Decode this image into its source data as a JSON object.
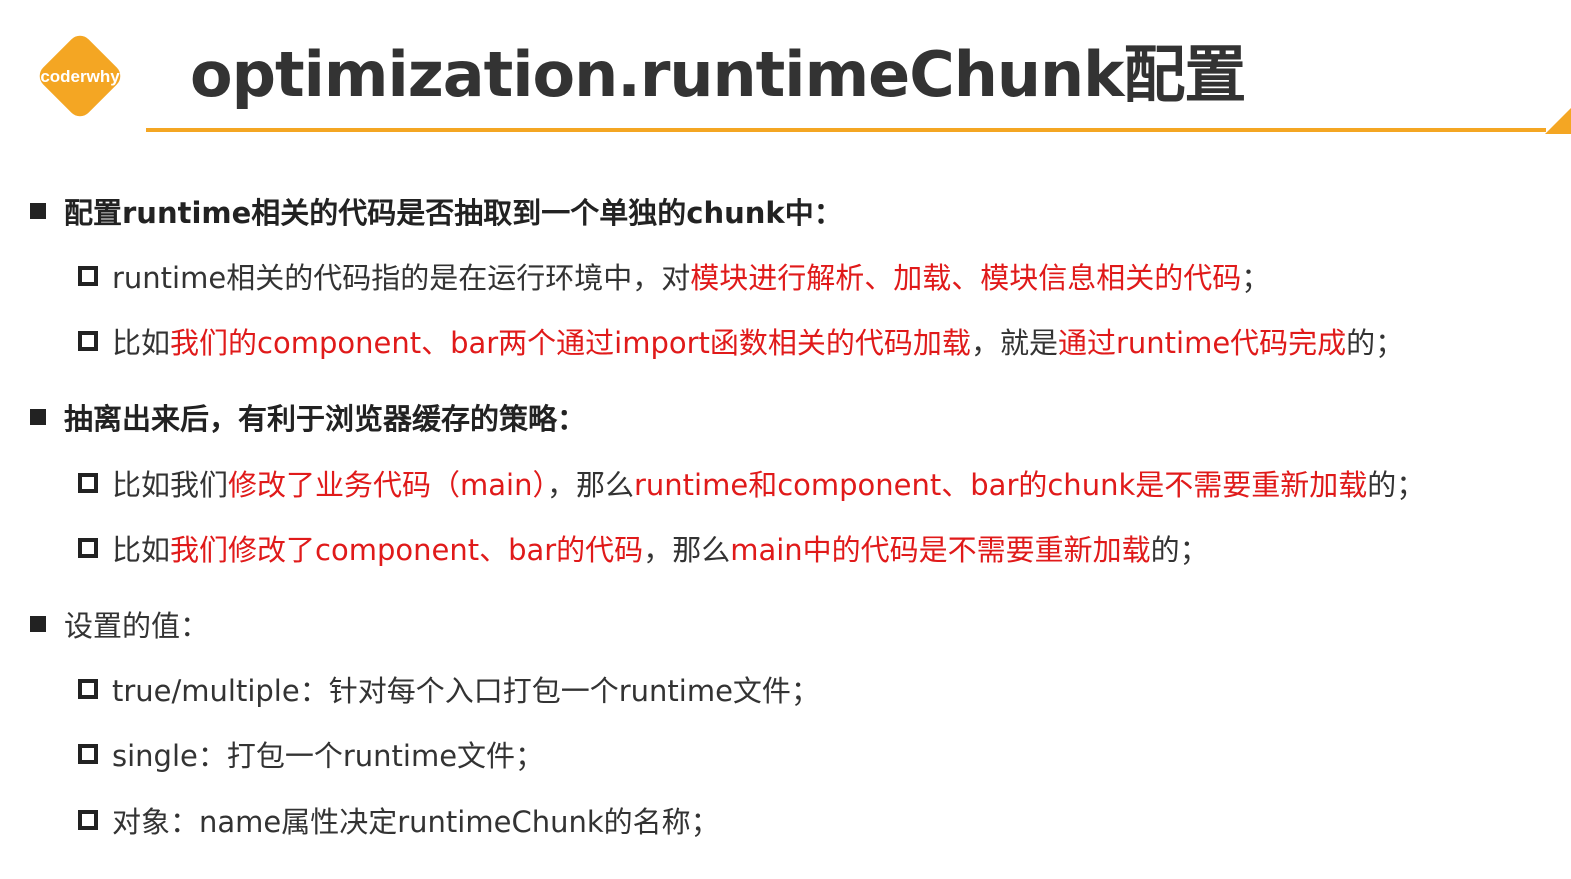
{
  "logo": {
    "text": "coderwhy",
    "color": "#f4a623"
  },
  "title": "optimization.runtimeChunk配置",
  "accent": "#f4a623",
  "highlight": "#e01a1a",
  "sections": [
    {
      "heading": "配置runtime相关的代码是否抽取到一个单独的chunk中：",
      "items": [
        {
          "segments": [
            {
              "text": "runtime相关的代码指的是在运行环境中，对"
            },
            {
              "text": "模块进行解析、加载、模块信息相关的代码"
            },
            {
              "text": "；"
            }
          ]
        },
        {
          "segments": [
            {
              "text": "比如"
            },
            {
              "text": "我们的component、bar两个通过import函数相关的代码加载"
            },
            {
              "text": "，就是"
            },
            {
              "text": "通过runtime代码完成"
            },
            {
              "text": "的；"
            }
          ]
        }
      ]
    },
    {
      "heading": "抽离出来后，有利于浏览器缓存的策略：",
      "items": [
        {
          "segments": [
            {
              "text": "比如我们"
            },
            {
              "text": "修改了业务代码（main）"
            },
            {
              "text": "，那么"
            },
            {
              "text": "runtime和component、bar的chunk是不需要重新加载"
            },
            {
              "text": "的；"
            }
          ]
        },
        {
          "segments": [
            {
              "text": "比如"
            },
            {
              "text": "我们修改了component、bar的代码"
            },
            {
              "text": "，那么"
            },
            {
              "text": "main中的代码是不需要重新加载"
            },
            {
              "text": "的；"
            }
          ]
        }
      ]
    },
    {
      "heading": "设置的值：",
      "items": [
        {
          "segments": [
            {
              "text": "true/multiple：针对每个入口打包一个runtime文件；"
            }
          ]
        },
        {
          "segments": [
            {
              "text": "single：打包一个runtime文件；"
            }
          ]
        },
        {
          "segments": [
            {
              "text": "对象：name属性决定runtimeChunk的名称；"
            }
          ]
        }
      ]
    }
  ]
}
